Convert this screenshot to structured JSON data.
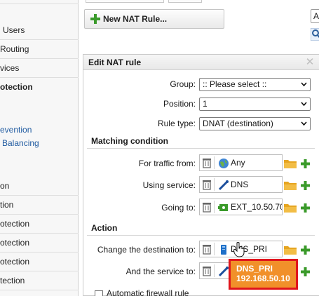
{
  "sidebar": {
    "items": [
      {
        "label": "Users",
        "bold": false
      },
      {
        "label": "Routing",
        "bold": false
      },
      {
        "label": "vices",
        "bold": false
      },
      {
        "label": "otection",
        "bold": true
      }
    ],
    "subitems": [
      {
        "label": "evention"
      },
      {
        "label": "Balancing"
      }
    ],
    "lower_items": [
      {
        "label": "on"
      },
      {
        "label": "tion"
      },
      {
        "label": "otection"
      },
      {
        "label": "otection"
      },
      {
        "label": "otection"
      },
      {
        "label": "tection"
      },
      {
        "label": "rotection"
      }
    ]
  },
  "toolbar": {
    "new_rule_label": "New NAT Rule...",
    "right_letter": "A"
  },
  "panel": {
    "title": "Edit NAT rule",
    "close_glyph": "✕",
    "group": {
      "label": "Group:",
      "value": ":: Please select ::"
    },
    "position": {
      "label": "Position:",
      "value": "1"
    },
    "rule_type": {
      "label": "Rule type:",
      "value": "DNAT (destination)"
    },
    "matching_title": "Matching condition",
    "traffic_from": {
      "label": "For traffic from:",
      "value": "Any",
      "icon": "globe-icon"
    },
    "using_service": {
      "label": "Using service:",
      "value": "DNS",
      "icon": "service-icon"
    },
    "going_to": {
      "label": "Going to:",
      "value": "EXT_10.50.70",
      "icon": "interface-address-icon"
    },
    "action_title": "Action",
    "change_destination": {
      "label": "Change the destination to:",
      "value": "DNS_PRI",
      "icon": "host-icon"
    },
    "and_service": {
      "label": "And the service to:",
      "value": "",
      "icon": "service-icon"
    },
    "auto_firewall_label": "Automatic firewall rule"
  },
  "tooltip": {
    "name": "DNS_PRI",
    "address": "192.168.50.10"
  },
  "colors": {
    "accent_orange": "#f1902a",
    "highlight_red": "#e0141c",
    "add_green": "#3a9a2a",
    "link_blue": "#1f5aa0"
  }
}
